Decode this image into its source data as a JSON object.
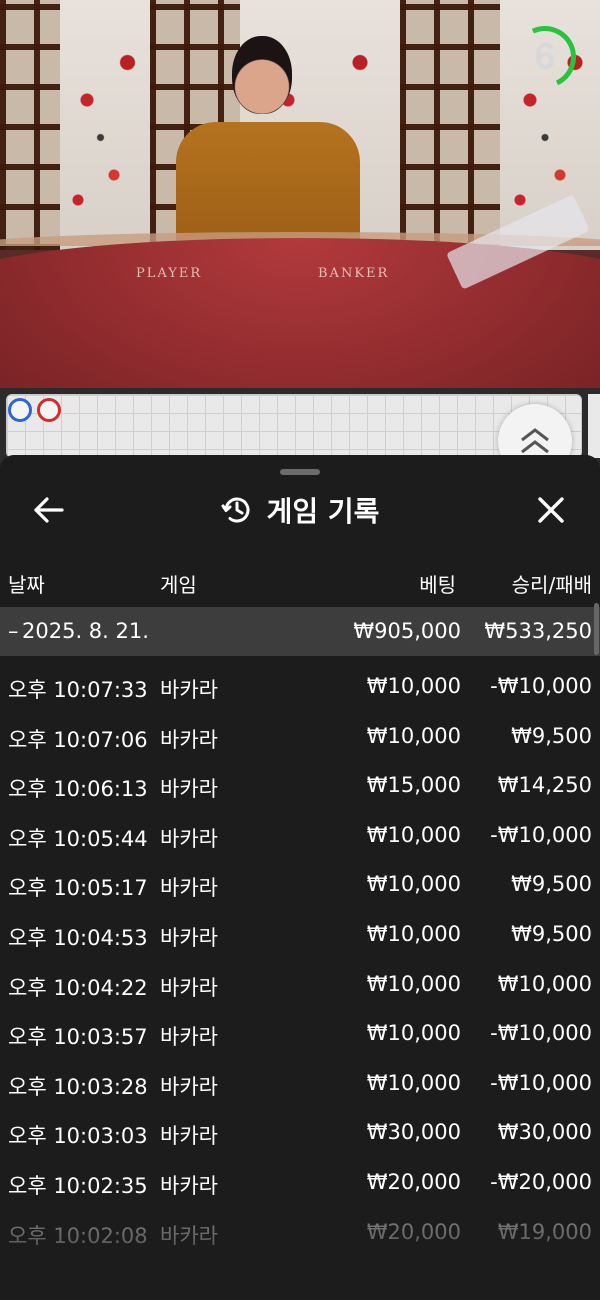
{
  "video": {
    "timer": "6",
    "felt_left": "PLAYER",
    "felt_right": "BANKER"
  },
  "colors": {
    "timer_ring": "#27c43d",
    "player_bead": "#2f64d6",
    "banker_bead": "#d22c2c",
    "sheet_bg": "#1c1c1c"
  },
  "header": {
    "title": "게임 기록"
  },
  "icons": {
    "back": "arrow-left-icon",
    "history": "history-clock-icon",
    "close": "close-icon",
    "expand": "chevron-double-up-icon"
  },
  "columns": {
    "date": "날짜",
    "game": "게임",
    "bet": "베팅",
    "result": "승리/패배"
  },
  "day": {
    "date": "2025. 8. 21.",
    "bet": "₩905,000",
    "result": "₩533,250"
  },
  "rows": [
    {
      "time": "오후 10:07:33",
      "game": "바카라",
      "bet": "₩10,000",
      "result": "-₩10,000"
    },
    {
      "time": "오후 10:07:06",
      "game": "바카라",
      "bet": "₩10,000",
      "result": "₩9,500"
    },
    {
      "time": "오후 10:06:13",
      "game": "바카라",
      "bet": "₩15,000",
      "result": "₩14,250"
    },
    {
      "time": "오후 10:05:44",
      "game": "바카라",
      "bet": "₩10,000",
      "result": "-₩10,000"
    },
    {
      "time": "오후 10:05:17",
      "game": "바카라",
      "bet": "₩10,000",
      "result": "₩9,500"
    },
    {
      "time": "오후 10:04:53",
      "game": "바카라",
      "bet": "₩10,000",
      "result": "₩9,500"
    },
    {
      "time": "오후 10:04:22",
      "game": "바카라",
      "bet": "₩10,000",
      "result": "₩10,000"
    },
    {
      "time": "오후 10:03:57",
      "game": "바카라",
      "bet": "₩10,000",
      "result": "-₩10,000"
    },
    {
      "time": "오후 10:03:28",
      "game": "바카라",
      "bet": "₩10,000",
      "result": "-₩10,000"
    },
    {
      "time": "오후 10:03:03",
      "game": "바카라",
      "bet": "₩30,000",
      "result": "₩30,000"
    },
    {
      "time": "오후 10:02:35",
      "game": "바카라",
      "bet": "₩20,000",
      "result": "-₩20,000"
    },
    {
      "time": "오후 10:02:08",
      "game": "바카라",
      "bet": "₩20,000",
      "result": "₩19,000"
    }
  ]
}
